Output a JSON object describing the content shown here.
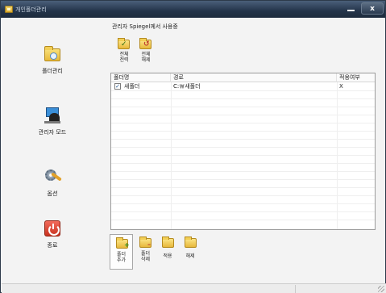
{
  "window": {
    "title": "개인폴더관리"
  },
  "header": {
    "text": "관리자 Spiegel께서 사용중"
  },
  "sidebar": {
    "items": [
      {
        "label": "폴더관리",
        "icon": "folder-icon"
      },
      {
        "label": "관리자 모드",
        "icon": "admin-user-icon"
      },
      {
        "label": "옵션",
        "icon": "settings-icon"
      },
      {
        "label": "종료",
        "icon": "power-icon"
      }
    ]
  },
  "top_toolbar": {
    "apply_all": "전체\n전력",
    "release_all": "전체\n해제"
  },
  "table": {
    "columns": [
      "폴더명",
      "경로",
      "적용여부"
    ],
    "rows": [
      {
        "checked": true,
        "name": "새폴더",
        "path": "C:￦새폴더",
        "applied": "X"
      }
    ]
  },
  "bottom_toolbar": {
    "add": "폴더\n추가",
    "delete": "폴더\n삭제",
    "apply": "적용",
    "release": "해제"
  },
  "colors": {
    "titlebar": "#24344a",
    "folder": "#f3cf55",
    "power": "#d9412e"
  }
}
